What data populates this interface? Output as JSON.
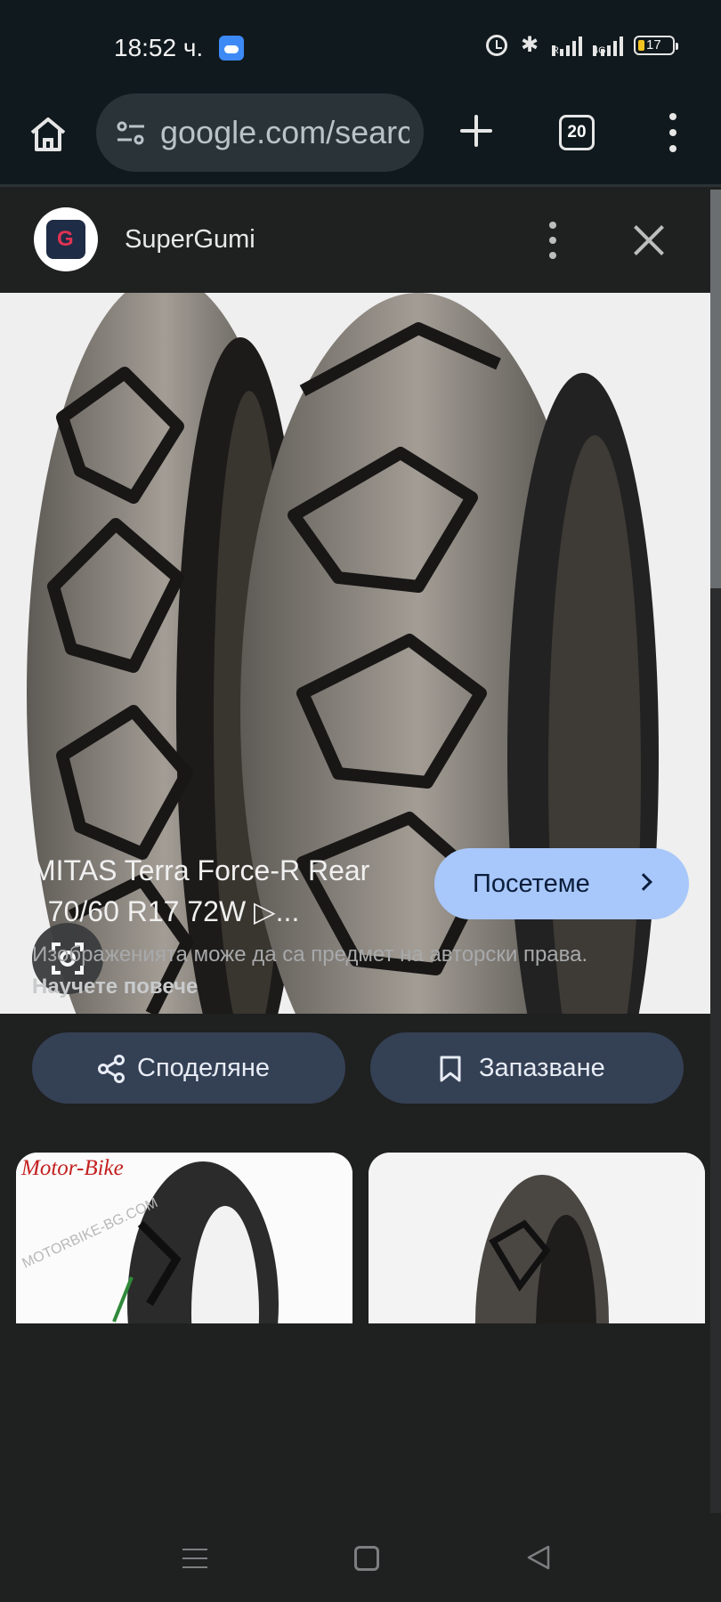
{
  "status_bar": {
    "time": "18:52 ч.",
    "network": "4G",
    "roaming": "R",
    "battery": "17"
  },
  "browser": {
    "url": "google.com/search",
    "tab_count": "20"
  },
  "result": {
    "site_name": "SuperGumi",
    "title": "MITAS Terra Force-R Rear 170/60 R17 72W ▷...",
    "visit_label": "Посетеме",
    "copyright_text": "Изображенията може да са предмет на авторски права.",
    "learn_more": "Научете повече",
    "share_label": "Споделяне",
    "save_label": "Запазване"
  },
  "related": [
    {
      "label": "Motor-Bike",
      "watermark": "MOTORBIKE-BG.COM"
    },
    {
      "label": ""
    }
  ],
  "colors": {
    "accent": "#a8c7fa",
    "chip": "#344054",
    "background": "#1f2020"
  }
}
